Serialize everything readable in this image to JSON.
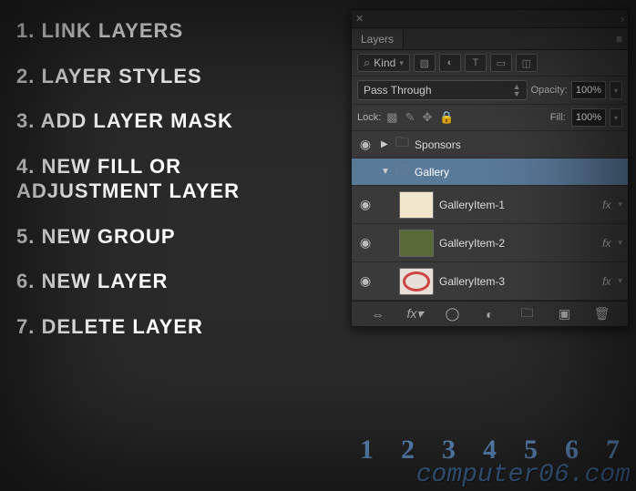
{
  "legend": [
    "1. LINK LAYERS",
    "2. LAYER STYLES",
    "3. ADD LAYER MASK",
    "4. NEW FILL OR\n    ADJUSTMENT LAYER",
    "5. NEW GROUP",
    "6. NEW LAYER",
    "7. DELETE LAYER"
  ],
  "panel": {
    "tab": "Layers",
    "filter_kind": "Kind",
    "blend_mode": "Pass Through",
    "opacity_label": "Opacity:",
    "opacity_value": "100%",
    "lock_label": "Lock:",
    "fill_label": "Fill:",
    "fill_value": "100%",
    "layers": [
      {
        "name": "Sponsors",
        "type": "group",
        "expanded": false,
        "selected": false
      },
      {
        "name": "Gallery",
        "type": "group",
        "expanded": true,
        "selected": true
      },
      {
        "name": "GalleryItem-1",
        "type": "layer",
        "fx": true
      },
      {
        "name": "GalleryItem-2",
        "type": "layer",
        "fx": true
      },
      {
        "name": "GalleryItem-3",
        "type": "layer",
        "fx": true
      }
    ],
    "footer_numbers": [
      "1",
      "2",
      "3",
      "4",
      "5",
      "6",
      "7"
    ]
  },
  "watermark": "computer06.com"
}
